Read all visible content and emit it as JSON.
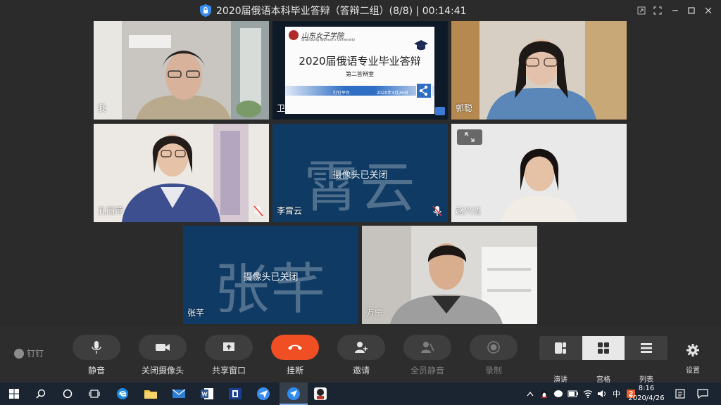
{
  "window": {
    "title": "2020届俄语本科毕业答辩（答辩二组）(8/8) | 00:14:41"
  },
  "participants": [
    {
      "name": "我",
      "camera": "on"
    },
    {
      "name": "卫",
      "camera": "screen-share"
    },
    {
      "name": "郭聪",
      "camera": "on"
    },
    {
      "name": "孔丽萍",
      "camera": "on",
      "muted": true
    },
    {
      "name": "李霄云",
      "camera": "off",
      "avatar_text": "霄云",
      "muted": true
    },
    {
      "name": "赵兴洁",
      "camera": "on"
    },
    {
      "name": "张芊",
      "camera": "off",
      "avatar_text": "张芊"
    },
    {
      "name": "万宁",
      "camera": "on"
    }
  ],
  "camera_off_text": "摄像头已关闭",
  "slide": {
    "school_name": "山东女子学院",
    "school_en": "Shandong Women's University",
    "title": "2020届俄语专业毕业答辩",
    "subtitle": "第二答辩室",
    "platform": "钉钉平台",
    "date": "2020年4月26日"
  },
  "toolbar": {
    "brand": "钉钉",
    "buttons": [
      {
        "id": "mute",
        "label": "静音",
        "icon": "microphone-icon"
      },
      {
        "id": "camera",
        "label": "关闭摄像头",
        "icon": "video-camera-icon"
      },
      {
        "id": "share",
        "label": "共享窗口",
        "icon": "share-screen-icon"
      },
      {
        "id": "hangup",
        "label": "挂断",
        "icon": "phone-hangup-icon"
      },
      {
        "id": "invite",
        "label": "邀请",
        "icon": "add-user-icon"
      },
      {
        "id": "mute_all",
        "label": "全员静音",
        "icon": "mute-all-icon",
        "disabled": true
      },
      {
        "id": "record",
        "label": "录制",
        "icon": "record-icon",
        "disabled": true
      }
    ],
    "views": [
      {
        "id": "speaker",
        "label": "演讲"
      },
      {
        "id": "grid",
        "label": "宫格",
        "active": true
      },
      {
        "id": "list",
        "label": "列表"
      }
    ],
    "settings_label": "设置"
  },
  "taskbar": {
    "time": "8:16",
    "date": "2020/4/26",
    "ime": "中"
  },
  "colors": {
    "hangup": "#f04e23",
    "camera_off_bg": "#0f3a63",
    "toolbar_bg": "#2d2d2d"
  }
}
